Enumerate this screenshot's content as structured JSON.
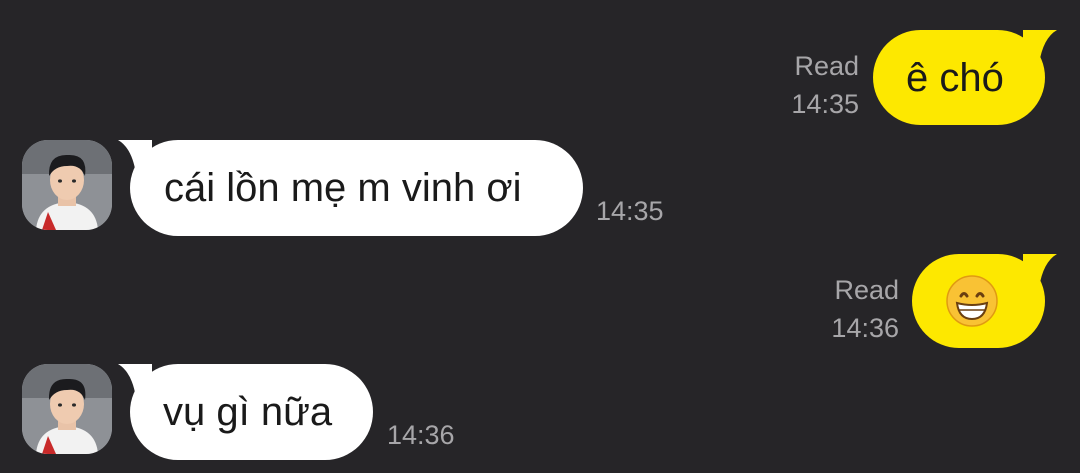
{
  "colors": {
    "background": "#262528",
    "outgoing_bubble": "#fde800",
    "incoming_bubble": "#ffffff",
    "meta_text": "#a7a6a9"
  },
  "messages": [
    {
      "direction": "outgoing",
      "text": "ê chó",
      "status": "Read",
      "time": "14:35"
    },
    {
      "direction": "incoming",
      "text": "cái lồn mẹ m vinh ơi",
      "time": "14:35",
      "avatar_icon": "profile-photo"
    },
    {
      "direction": "outgoing",
      "text": "😁",
      "status": "Read",
      "time": "14:36"
    },
    {
      "direction": "incoming",
      "text": "vụ gì nữa",
      "time": "14:36",
      "avatar_icon": "profile-photo"
    }
  ]
}
